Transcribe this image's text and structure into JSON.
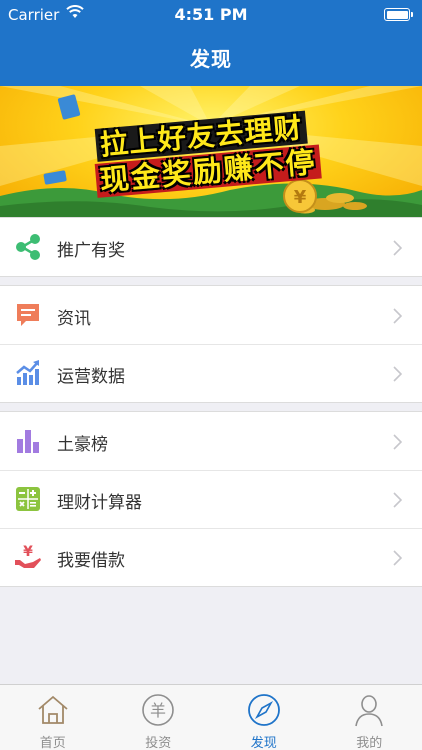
{
  "status_bar": {
    "carrier": "Carrier",
    "time": "4:51 PM"
  },
  "nav": {
    "title": "发现"
  },
  "banner": {
    "line1": "拉上好友去理财",
    "line2": "现金奖励赚不停",
    "coin_symbol": "¥"
  },
  "groups": [
    {
      "items": [
        {
          "label": "推广有奖",
          "icon": "share-icon",
          "color": "#3dbd73"
        }
      ]
    },
    {
      "items": [
        {
          "label": "资讯",
          "icon": "message-icon",
          "color": "#ef7d5a"
        },
        {
          "label": "运营数据",
          "icon": "trend-chart-icon",
          "color": "#5b8ee6"
        }
      ]
    },
    {
      "items": [
        {
          "label": "土豪榜",
          "icon": "bar-chart-icon",
          "color": "#a27be0"
        },
        {
          "label": "理财计算器",
          "icon": "calculator-icon",
          "color": "#8cc43f"
        },
        {
          "label": "我要借款",
          "icon": "loan-hand-icon",
          "color": "#e2505a"
        }
      ]
    }
  ],
  "tabbar": {
    "items": [
      {
        "label": "首页",
        "icon": "home-icon"
      },
      {
        "label": "投资",
        "icon": "yuan-coin-icon",
        "glyph": "羊"
      },
      {
        "label": "发现",
        "icon": "compass-icon"
      },
      {
        "label": "我的",
        "icon": "person-icon"
      }
    ],
    "active_index": 2,
    "active_color": "#1f74c9",
    "inactive_color": "#8e8e8e"
  },
  "colors": {
    "nav_bar": "#1f74c9",
    "background": "#efeff4"
  }
}
